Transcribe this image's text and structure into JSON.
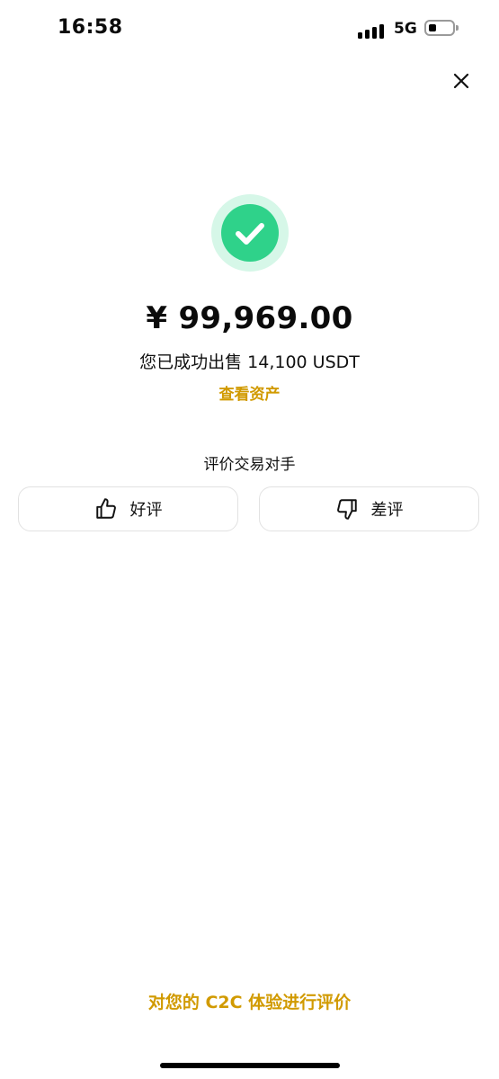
{
  "status_bar": {
    "time": "16:58",
    "network": "5G",
    "signal_level": 4,
    "battery_level": 0.3
  },
  "icons": {
    "close": "close-icon",
    "success": "check-circle-icon",
    "good": "thumbs-up-icon",
    "bad": "thumbs-down-icon"
  },
  "result": {
    "amount": "¥ 99,969.00",
    "message": "您已成功出售 14,100 USDT",
    "view_assets_label": "查看资产"
  },
  "rating": {
    "title": "评价交易对手",
    "good_label": "好评",
    "bad_label": "差评"
  },
  "footer": {
    "feedback_link": "对您的 C2C 体验进行评价"
  },
  "colors": {
    "accent": "#d19a00",
    "success": "#2fd28a",
    "success_halo": "#d6f7e8"
  }
}
